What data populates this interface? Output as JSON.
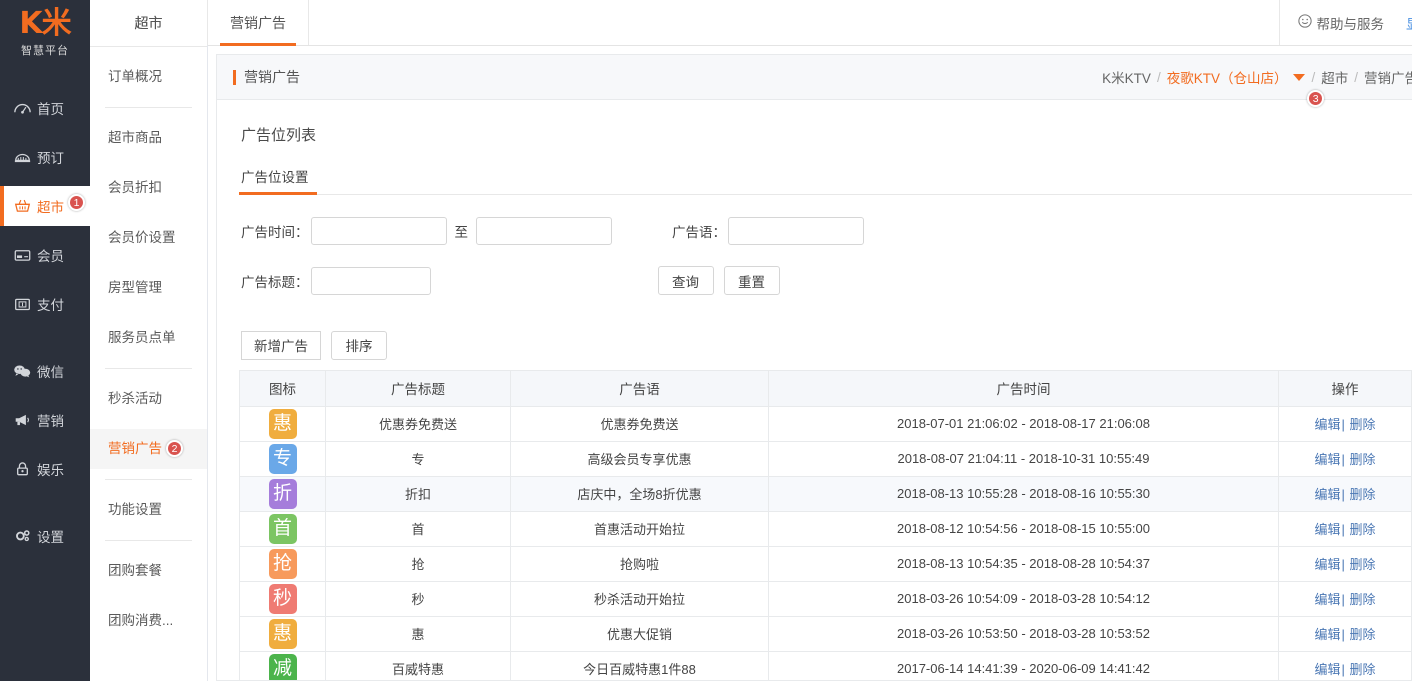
{
  "brand": {
    "logo_text": "K米",
    "logo_sub": "智慧平台"
  },
  "accent_color": "#f26c20",
  "badge_color": "#d9534f",
  "sidebar": {
    "items": [
      {
        "label": "首页",
        "icon": "dashboard-icon",
        "active": false,
        "badge": ""
      },
      {
        "label": "预订",
        "icon": "booking-icon",
        "active": false,
        "badge": ""
      },
      {
        "label": "超市",
        "icon": "basket-icon",
        "active": true,
        "badge": "1"
      },
      {
        "label": "会员",
        "icon": "card-icon",
        "active": false,
        "badge": ""
      },
      {
        "label": "支付",
        "icon": "payment-icon",
        "active": false,
        "badge": ""
      },
      {
        "label": "微信",
        "icon": "wechat-icon",
        "active": false,
        "badge": ""
      },
      {
        "label": "营销",
        "icon": "megaphone-icon",
        "active": false,
        "badge": ""
      },
      {
        "label": "娱乐",
        "icon": "entertainment-icon",
        "active": false,
        "badge": ""
      },
      {
        "label": "设置",
        "icon": "gear-icon",
        "active": false,
        "badge": ""
      }
    ]
  },
  "submenu": {
    "title": "超市",
    "items": [
      {
        "label": "订单概况",
        "active": false,
        "badge": ""
      },
      {
        "label": "超市商品",
        "active": false,
        "badge": ""
      },
      {
        "label": "会员折扣",
        "active": false,
        "badge": ""
      },
      {
        "label": "会员价设置",
        "active": false,
        "badge": ""
      },
      {
        "label": "房型管理",
        "active": false,
        "badge": ""
      },
      {
        "label": "服务员点单",
        "active": false,
        "badge": ""
      },
      {
        "label": "秒杀活动",
        "active": false,
        "badge": ""
      },
      {
        "label": "营销广告",
        "active": true,
        "badge": "2"
      },
      {
        "label": "功能设置",
        "active": false,
        "badge": ""
      },
      {
        "label": "团购套餐",
        "active": false,
        "badge": ""
      },
      {
        "label": "团购消费...",
        "active": false,
        "badge": ""
      }
    ]
  },
  "topbar": {
    "section_label": "超市",
    "active_tab": "营销广告",
    "help_label": "帮助与服务",
    "help_icon": "smiley-icon",
    "show_label": "显示"
  },
  "breadcrumb": {
    "title": "营销广告",
    "root": "K米KTV",
    "store": "夜歌KTV（仓山店）",
    "store_badge": "3",
    "path": [
      "超市",
      "营销广告"
    ]
  },
  "page": {
    "heading": "广告位列表",
    "tab_label": "广告位设置"
  },
  "form": {
    "time_label": "广告时间：",
    "time_start_value": "",
    "time_end_value": "",
    "time_sep": "至",
    "slogan_label": "广告语：",
    "slogan_value": "",
    "title_label": "广告标题：",
    "title_value": "",
    "search_button": "查询",
    "reset_button": "重置"
  },
  "toolbar": {
    "add_button": "新增广告",
    "sort_button": "排序"
  },
  "table": {
    "columns": [
      "图标",
      "广告标题",
      "广告语",
      "广告时间",
      "操作"
    ],
    "edit_label": "编辑",
    "delete_label": "删除",
    "separator": "|",
    "rows": [
      {
        "icon_char": "惠",
        "icon_color": "#f0ad3e",
        "title": "优惠券免费送",
        "slogan": "优惠券免费送",
        "time": "2018-07-01 21:06:02 - 2018-08-17 21:06:08"
      },
      {
        "icon_char": "专",
        "icon_color": "#6aa8e8",
        "title": "专",
        "slogan": "高级会员专享优惠",
        "time": "2018-08-07 21:04:11 - 2018-10-31 10:55:49"
      },
      {
        "icon_char": "折",
        "icon_color": "#a57ddb",
        "title": "折扣",
        "slogan": "店庆中，全场8折优惠",
        "time": "2018-08-13 10:55:28 - 2018-08-16 10:55:30"
      },
      {
        "icon_char": "首",
        "icon_color": "#7cc563",
        "title": "首",
        "slogan": "首惠活动开始拉",
        "time": "2018-08-12 10:54:56 - 2018-08-15 10:55:00"
      },
      {
        "icon_char": "抢",
        "icon_color": "#f79a5c",
        "title": "抢",
        "slogan": "抢购啦",
        "time": "2018-08-13 10:54:35 - 2018-08-28 10:54:37"
      },
      {
        "icon_char": "秒",
        "icon_color": "#ef7b73",
        "title": "秒",
        "slogan": "秒杀活动开始拉",
        "time": "2018-03-26 10:54:09 - 2018-03-28 10:54:12"
      },
      {
        "icon_char": "惠",
        "icon_color": "#f0ad3e",
        "title": "惠",
        "slogan": "优惠大促销",
        "time": "2018-03-26 10:53:50 - 2018-03-28 10:53:52"
      },
      {
        "icon_char": "减",
        "icon_color": "#4cb44c",
        "title": "百威特惠",
        "slogan": "今日百威特惠1件88",
        "time": "2017-06-14 14:41:39 - 2020-06-09 14:41:42"
      }
    ]
  }
}
